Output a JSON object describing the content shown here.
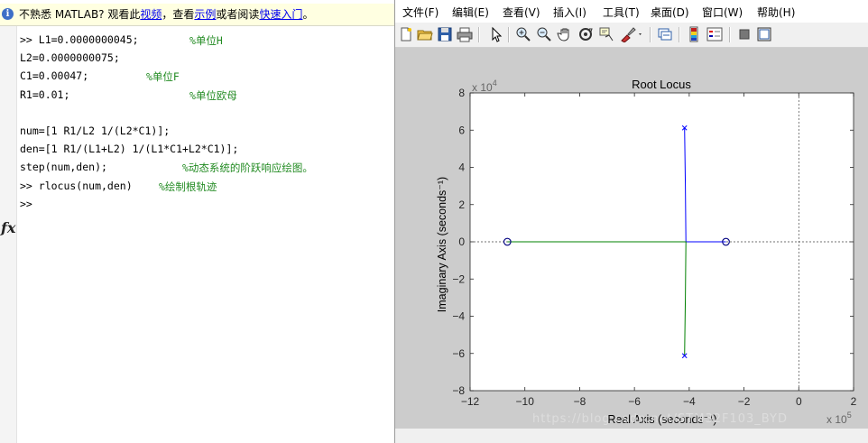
{
  "command_window": {
    "info_bar": {
      "text_before": "不熟悉 MATLAB? 观看此",
      "link_video": "视频",
      "text_mid1": "，查看",
      "link_examples": "示例",
      "text_mid2": "或者阅读",
      "link_quickstart": "快速入门",
      "text_end": "。"
    },
    "lines": [
      {
        "code": ">> L1=0.0000000045;",
        "comment": "%单位H"
      },
      {
        "code": "L2=0.0000000075;",
        "comment": ""
      },
      {
        "code": "C1=0.00047;",
        "comment": "%单位F"
      },
      {
        "code": "R1=0.01;",
        "comment": "%单位欧母"
      },
      {
        "code": "",
        "comment": ""
      },
      {
        "code": "num=[1 R1/L2 1/(L2*C1)];",
        "comment": ""
      },
      {
        "code": "den=[1 R1/(L1+L2) 1/(L1*C1+L2*C1)];",
        "comment": ""
      },
      {
        "code": "step(num,den);",
        "comment": "%动态系统的阶跃响应绘图。"
      },
      {
        "code": ">> rlocus(num,den)",
        "comment": "%绘制根轨迹"
      },
      {
        "code": ">>",
        "comment": ""
      }
    ],
    "fx_glyph": "fx"
  },
  "figure": {
    "menus": [
      "文件(F)",
      "编辑(E)",
      "查看(V)",
      "插入(I)",
      "工具(T)",
      "桌面(D)",
      "窗口(W)",
      "帮助(H)"
    ],
    "toolbar_icons": [
      "new-figure-icon",
      "open-icon",
      "save-icon",
      "print-icon",
      "edit-plot-arrow-icon",
      "zoom-in-icon",
      "zoom-out-icon",
      "pan-hand-icon",
      "rotate-3d-icon",
      "data-cursor-icon",
      "brush-icon",
      "link-plot-icon",
      "colorbar-icon",
      "legend-icon",
      "hide-plot-tools-icon",
      "show-plot-tools-icon"
    ],
    "watermark": "https://blog.csdn.net/STM32F103_BYD"
  },
  "chart_data": {
    "type": "scatter",
    "title": "Root Locus",
    "xlabel": "Real Axis (seconds⁻¹)",
    "ylabel": "Imaginary Axis (seconds⁻¹)",
    "x_exponent_label": "x 10",
    "x_exponent": "5",
    "y_exponent_label": "x 10",
    "y_exponent": "4",
    "xlim": [
      -12,
      2
    ],
    "ylim": [
      -8,
      8
    ],
    "x_unit_scale": 100000,
    "y_unit_scale": 10000,
    "xticks": [
      -12,
      -10,
      -8,
      -6,
      -4,
      -2,
      0,
      2
    ],
    "yticks": [
      -8,
      -6,
      -4,
      -2,
      0,
      2,
      4,
      6,
      8
    ],
    "grid": false,
    "zero_lines": "dashed",
    "colors": {
      "blue": "#0000ff",
      "green": "#008000",
      "axes_bg": "#ffffff",
      "figure_bg": "#cccccc"
    },
    "poles": [
      {
        "x": -4.17,
        "y": 6.12
      },
      {
        "x": -4.17,
        "y": -6.12
      }
    ],
    "zeros": [
      {
        "x": -10.64,
        "y": 0
      },
      {
        "x": -2.66,
        "y": 0
      }
    ],
    "series": [
      {
        "color": "blue",
        "points": [
          [
            -4.17,
            6.12
          ],
          [
            -4.14,
            3.0
          ],
          [
            -4.12,
            0
          ],
          [
            -3.0,
            0
          ],
          [
            -2.66,
            0
          ]
        ]
      },
      {
        "color": "green",
        "points": [
          [
            -4.17,
            -6.12
          ],
          [
            -4.14,
            -3.0
          ],
          [
            -4.12,
            0
          ],
          [
            -7.0,
            0
          ],
          [
            -10.64,
            0
          ]
        ]
      }
    ]
  }
}
